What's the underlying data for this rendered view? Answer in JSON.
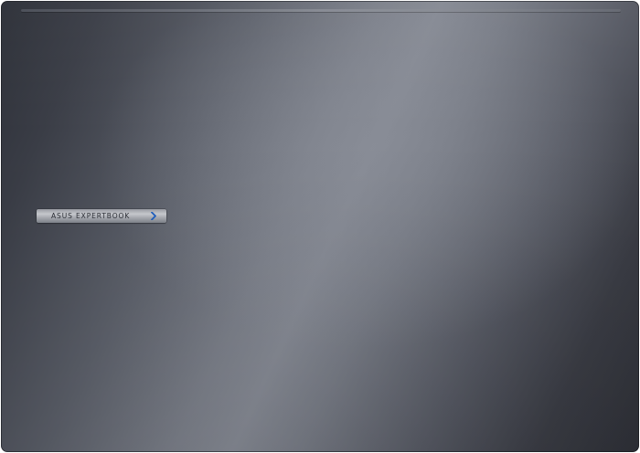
{
  "device": {
    "badge_text": "ASUS EXPERTBOOK",
    "badge_icon": "chevron-right-icon",
    "colors": {
      "lid_dark": "#2b2e36",
      "lid_highlight": "#858993",
      "badge_silver": "#c9cbd0",
      "chevron_blue": "#1f5fbf"
    }
  }
}
